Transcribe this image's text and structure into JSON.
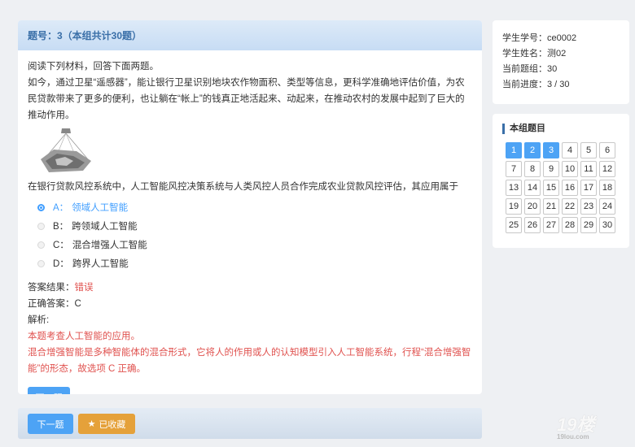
{
  "question": {
    "header": "题号：3（本组共计30题）",
    "intro": "阅读下列材料，回答下面两题。",
    "material": "如今，通过卫星“遥感器”，能让银行卫星识别地块农作物面积、类型等信息，更科学准确地评估价值，为农民贷款带来了更多的便利，也让躺在“帐上”的钱真正地活起来、动起来，在推动农村的发展中起到了巨大的推动作用。",
    "stem": "在银行贷款风控系统中，人工智能风控决策系统与人类风控人员合作完成农业贷款风控评估，其应用属于",
    "options": [
      {
        "key": "A：",
        "text": "领域人工智能"
      },
      {
        "key": "B：",
        "text": "跨领域人工智能"
      },
      {
        "key": "C：",
        "text": "混合增强人工智能"
      },
      {
        "key": "D：",
        "text": "跨界人工智能"
      }
    ],
    "selected": "A",
    "result_label": "答案结果：",
    "result_value": "错误",
    "correct_label": "正确答案：",
    "correct_value": "C",
    "analysis_label": "解析:",
    "analysis_line1": "本题考查人工智能的应用。",
    "analysis_line2": "混合增强智能是多种智能体的混合形式，它将人的作用或人的认知模型引入人工智能系统，行程“混合增强智能”的形态，故选项 C 正确。",
    "next_label": "下一题"
  },
  "footer": {
    "next_label": "下一题",
    "fav_label": "已收藏",
    "fav_icon": "star-icon"
  },
  "info": {
    "student_id_label": "学生学号：",
    "student_id": "ce0002",
    "student_name_label": "学生姓名：",
    "student_name": "测02",
    "group_label": "当前题组：",
    "group": "30",
    "progress_label": "当前进度：",
    "progress": "3 / 30"
  },
  "grid": {
    "title": "本组题目",
    "items": [
      "1",
      "2",
      "3",
      "4",
      "5",
      "6",
      "7",
      "8",
      "9",
      "10",
      "11",
      "12",
      "13",
      "14",
      "15",
      "16",
      "17",
      "18",
      "19",
      "20",
      "21",
      "22",
      "23",
      "24",
      "25",
      "26",
      "27",
      "28",
      "29",
      "30"
    ],
    "done_count": 3
  },
  "colors": {
    "accent": "#4da3f5",
    "error": "#e0524f",
    "fav": "#e5a13a"
  }
}
